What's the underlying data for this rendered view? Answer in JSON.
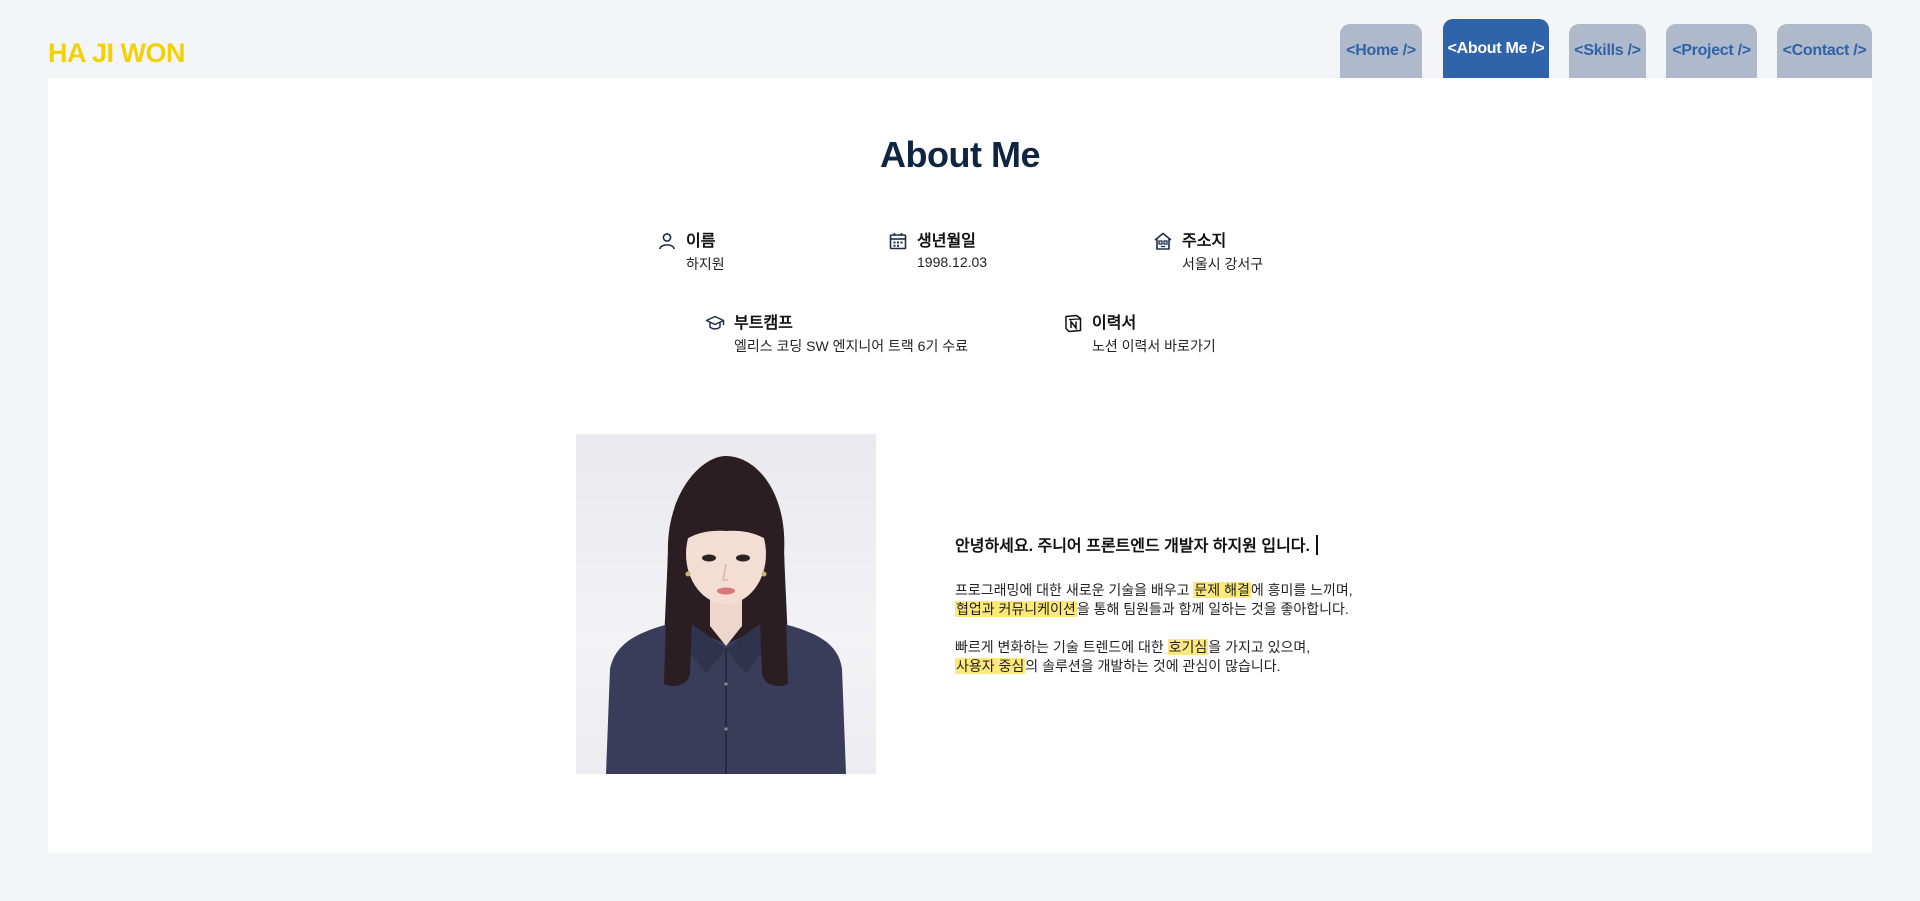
{
  "logo": "HA JI WON",
  "nav": {
    "tabs": [
      {
        "label": "<Home />"
      },
      {
        "label": "<About Me />"
      },
      {
        "label": "<Skills />"
      },
      {
        "label": "<Project />"
      },
      {
        "label": "<Contact />"
      }
    ],
    "active": "<About Me />"
  },
  "about": {
    "title": "About Me",
    "info": [
      {
        "icon": "person-icon",
        "label": "이름",
        "value": "하지원"
      },
      {
        "icon": "calendar-icon",
        "label": "생년월일",
        "value": "1998.12.03"
      },
      {
        "icon": "house-icon",
        "label": "주소지",
        "value": "서울시 강서구"
      },
      {
        "icon": "graduation-cap-icon",
        "label": "부트캠프",
        "value": "엘리스 코딩 SW 엔지니어 트랙 6기 수료"
      },
      {
        "icon": "notion-icon",
        "label": "이력서",
        "value": "노션 이력서 바로가기"
      }
    ],
    "intro": {
      "heading": "안녕하세요. 주니어 프론트엔드 개발자 하지원 입니다.",
      "p1": [
        {
          "text": "프로그래밍에 대한 새로운 기술을 배우고 "
        },
        {
          "text": "문제 해결",
          "highlight": true
        },
        {
          "text": "에 흥미를 느끼며,"
        }
      ],
      "p1b": [
        {
          "text": "협업과 커뮤니케이션",
          "highlight": true
        },
        {
          "text": "을 통해 팀원들과 함께 일하는 것을 좋아합니다."
        }
      ],
      "p2": [
        {
          "text": "빠르게 변화하는 기술 트렌드에 대한 "
        },
        {
          "text": "호기심",
          "highlight": true
        },
        {
          "text": "을 가지고 있으며,"
        }
      ],
      "p2b": [
        {
          "text": "사용자 중심",
          "highlight": true
        },
        {
          "text": "의 솔루션을 개발하는 것에 관심이 많습니다."
        }
      ]
    },
    "highlight_color": "#fde87a"
  },
  "colors": {
    "logo": "#f2d10a",
    "tab_inactive": "#aebacb",
    "tab_active": "#2f63aa",
    "tab_text": "#2f62a8",
    "title": "#0f2542"
  }
}
